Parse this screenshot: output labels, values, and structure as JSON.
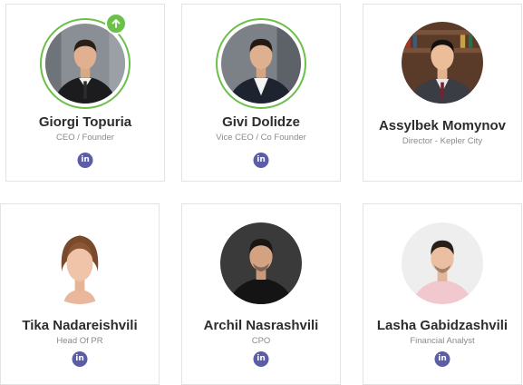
{
  "team": [
    {
      "name": "Giorgi Topuria",
      "role": "CEO / Founder",
      "icon": "linkedin-icon",
      "badge_icon": "arrow-up-icon"
    },
    {
      "name": "Givi Dolidze",
      "role": "Vice CEO / Co Founder",
      "icon": "linkedin-icon"
    },
    {
      "name": "Assylbek Momynov",
      "role": "Director - Kepler City",
      "icon": "linkedin-icon"
    },
    {
      "name": "Tika Nadareishvili",
      "role": "Head Of PR",
      "icon": "linkedin-icon"
    },
    {
      "name": "Archil Nasrashvili",
      "role": "CPO",
      "icon": "linkedin-icon"
    },
    {
      "name": "Lasha Gabidzashvili",
      "role": "Financial Analyst",
      "icon": "linkedin-icon"
    }
  ],
  "linkedin_label": "in",
  "colors": {
    "accent_ring": "#6cc04a",
    "linkedin": "#5b5ea6",
    "name": "#2d2d2d",
    "role": "#8a8a8a"
  }
}
